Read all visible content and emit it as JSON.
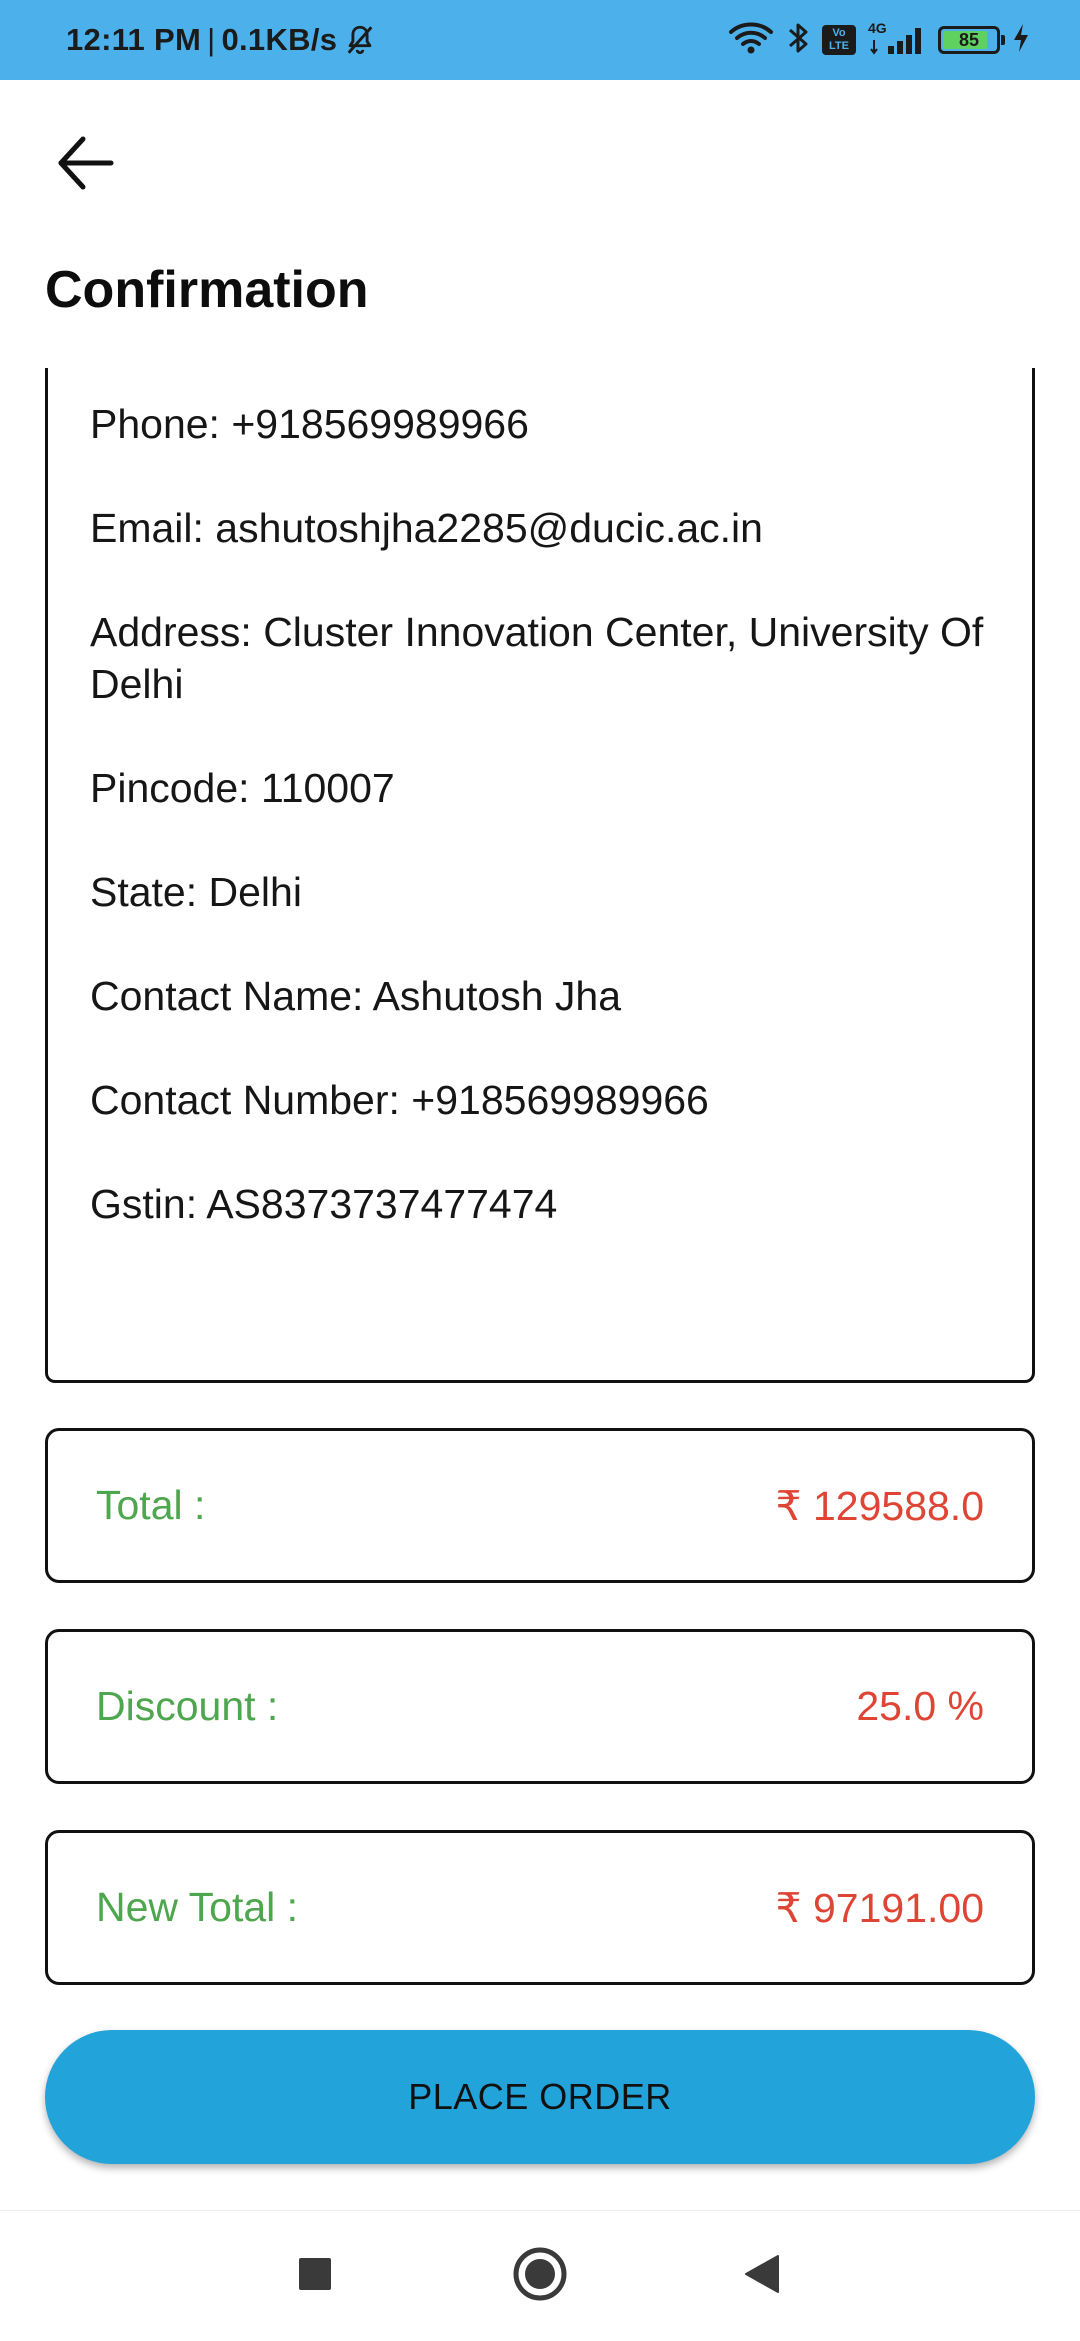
{
  "status_bar": {
    "time": "12:11 PM",
    "separator": "|",
    "net_speed": "0.1KB/s",
    "volte_top": "Vo",
    "volte_bottom": "LTE",
    "network_type": "4G",
    "battery_level": "85",
    "battery_fraction": 0.85,
    "background_color": "#4cb1eb"
  },
  "header": {
    "title": "Confirmation",
    "back_icon": "arrow-left-icon"
  },
  "details": {
    "phone": "Phone: +918569989966",
    "email": "Email: ashutoshjha2285@ducic.ac.in",
    "address": "Address: Cluster Innovation Center, University Of Delhi",
    "pincode": "Pincode: 110007",
    "state": "State: Delhi",
    "contact_name": "Contact Name: Ashutosh Jha",
    "contact_number": "Contact Number: +918569989966",
    "gstin": "Gstin: AS8373737477474"
  },
  "summary": {
    "total_label": "Total :",
    "total_value": "₹ 129588.0",
    "discount_label": "Discount :",
    "discount_value": "25.0 %",
    "new_total_label": "New Total :",
    "new_total_value": "₹ 97191.00",
    "label_color": "#4ea64e",
    "value_color": "#de4535"
  },
  "actions": {
    "place_order_label": "PLACE ORDER",
    "button_color": "#22a3d9"
  },
  "nav_bar": {
    "recents_icon": "square-icon",
    "home_icon": "circle-icon",
    "back_icon": "triangle-back-icon"
  }
}
